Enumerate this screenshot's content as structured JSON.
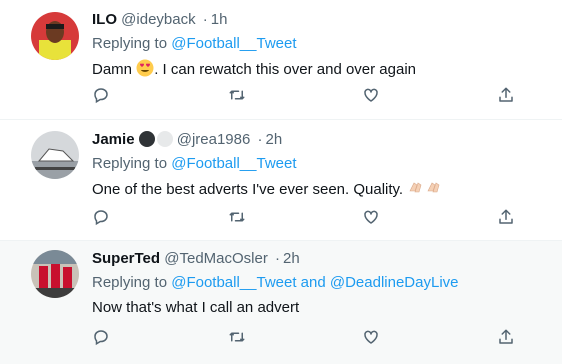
{
  "replies": [
    {
      "name": "ILO",
      "handle": "@ideyback",
      "separator": "·",
      "time": "1h",
      "replying_prefix": "Replying to",
      "replying_to": "@Football__Tweet",
      "text_before": "Damn ",
      "text_after": ". I can rewatch this over and over again",
      "emoji": "heart-eyes-emoji"
    },
    {
      "name": "Jamie",
      "handle": "@jrea1986",
      "separator": "·",
      "time": "2h",
      "replying_prefix": "Replying to",
      "replying_to": "@Football__Tweet",
      "text": "One of the best adverts I've ever seen. Quality.",
      "emoji": "clapping-hands-emoji"
    },
    {
      "name": "SuperTed",
      "handle": "@TedMacOsler",
      "separator": "·",
      "time": "2h",
      "replying_prefix": "Replying to",
      "replying_to": "@Football__Tweet and @DeadlineDayLive",
      "text": "Now that's what I call an advert"
    }
  ],
  "colors": {
    "link": "#1d9bf0",
    "secondary": "#536471",
    "hover_bg": "#f7f9f9"
  },
  "icons": [
    "reply-icon",
    "retweet-icon",
    "like-icon",
    "share-icon"
  ]
}
